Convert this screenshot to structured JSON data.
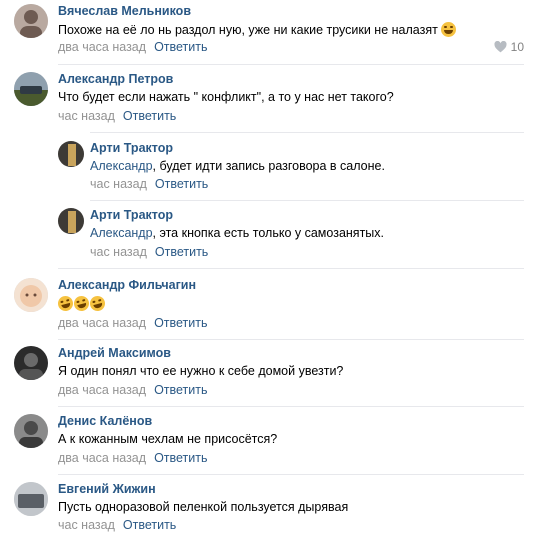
{
  "comments": [
    {
      "author": "Вячеслав Мельников",
      "text": "Похоже на её ло   нь раздол    ную, уже ни какие трусики не налазят",
      "time": "два часа назад",
      "reply": "Ответить",
      "likes": "10",
      "colors": [
        "#b9a9a0",
        "#6e5b52"
      ]
    },
    {
      "author": "Александр Петров",
      "text": "Что будет если нажать \" конфликт\", а то у нас нет такого?",
      "time": "час назад",
      "reply": "Ответить",
      "colors": [
        "#7d8c9a",
        "#4a5a2e"
      ]
    },
    {
      "author": "Арти Трактор",
      "addressee": "Александр",
      "text": ", будет идти запись разговора в салоне.",
      "time": "час назад",
      "reply": "Ответить",
      "colors": [
        "#c9a45c",
        "#3d3a36"
      ]
    },
    {
      "author": "Арти Трактор",
      "addressee": "Александр",
      "text": ", эта кнопка есть только у самозанятых.",
      "time": "час назад",
      "reply": "Ответить",
      "colors": [
        "#c9a45c",
        "#3d3a36"
      ]
    },
    {
      "author": "Александр Фильчагин",
      "text": "",
      "time": "два часа назад",
      "reply": "Ответить",
      "colors": [
        "#f0c8a8",
        "#d99a78"
      ]
    },
    {
      "author": "Андрей Максимов",
      "text": "Я один понял что ее нужно к себе домой увезти?",
      "time": "два часа назад",
      "reply": "Ответить",
      "colors": [
        "#2b2b2b",
        "#6a6a6a"
      ]
    },
    {
      "author": "Денис Калёнов",
      "text": "А к кожанным чехлам не присосётся?",
      "time": "два часа назад",
      "reply": "Ответить",
      "colors": [
        "#4a4a4a",
        "#8a8a8a"
      ]
    },
    {
      "author": "Евгений Жижин",
      "text": "Пусть одноразовой пеленкой пользуется дырявая",
      "time": "час назад",
      "reply": "Ответить",
      "colors": [
        "#9ea3a8",
        "#5a5f66"
      ]
    }
  ]
}
